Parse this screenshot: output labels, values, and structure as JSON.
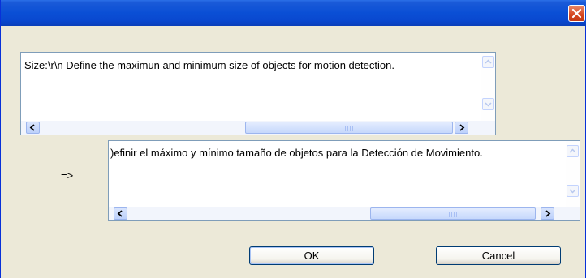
{
  "window": {
    "title": "",
    "close_icon": "close-icon",
    "accent_color": "#0a4fd5",
    "close_color": "#d5451f"
  },
  "source_box": {
    "text": "Size:\\r\\n Define the maximun and minimum size of objects for motion detection.",
    "scroll_thumb_label": "III"
  },
  "arrow_label": "=>",
  "target_box": {
    "text": ")efinir el máximo y mínimo tamaño de objetos para la Detección de Movimiento.",
    "scroll_thumb_label": "III"
  },
  "buttons": {
    "ok_label": "OK",
    "cancel_label": "Cancel"
  }
}
